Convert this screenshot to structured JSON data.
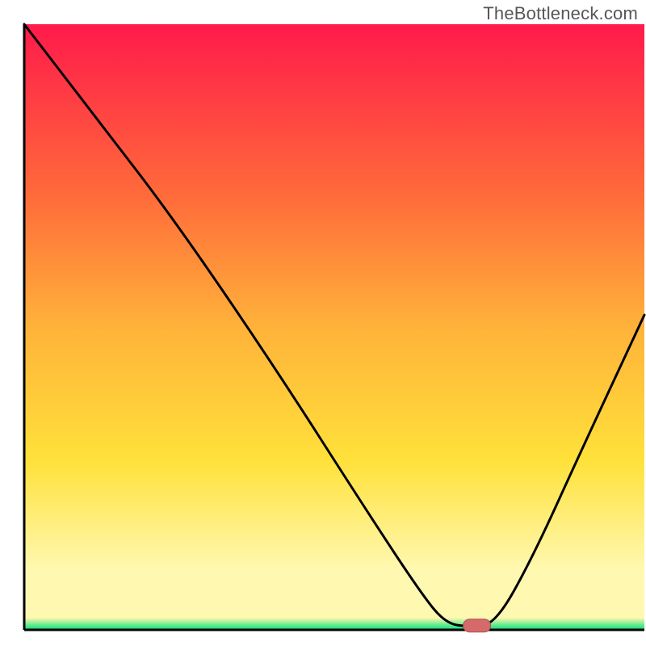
{
  "attribution": "TheBottleneck.com",
  "colors": {
    "gradient_top": "#ff1a4b",
    "gradient_mid1": "#ff6a3a",
    "gradient_mid2": "#ffb23a",
    "gradient_mid3": "#ffe13a",
    "gradient_light": "#fff8b0",
    "gradient_green": "#00e07a",
    "axis": "#000000",
    "curve": "#000000",
    "marker_fill": "#d46a6a",
    "marker_stroke": "#b04e4e"
  },
  "chart_data": {
    "type": "line",
    "title": "",
    "xlabel": "",
    "ylabel": "",
    "xlim": [
      0,
      100
    ],
    "ylim": [
      0,
      100
    ],
    "grid": false,
    "legend": false,
    "curve": [
      {
        "x": 0,
        "y": 100
      },
      {
        "x": 12,
        "y": 84
      },
      {
        "x": 24,
        "y": 68
      },
      {
        "x": 40,
        "y": 44
      },
      {
        "x": 55,
        "y": 20
      },
      {
        "x": 64,
        "y": 6
      },
      {
        "x": 68,
        "y": 1
      },
      {
        "x": 72,
        "y": 0.5
      },
      {
        "x": 76,
        "y": 1
      },
      {
        "x": 82,
        "y": 12
      },
      {
        "x": 90,
        "y": 30
      },
      {
        "x": 100,
        "y": 52
      }
    ],
    "marker": {
      "x": 73,
      "y": 0.7
    }
  }
}
